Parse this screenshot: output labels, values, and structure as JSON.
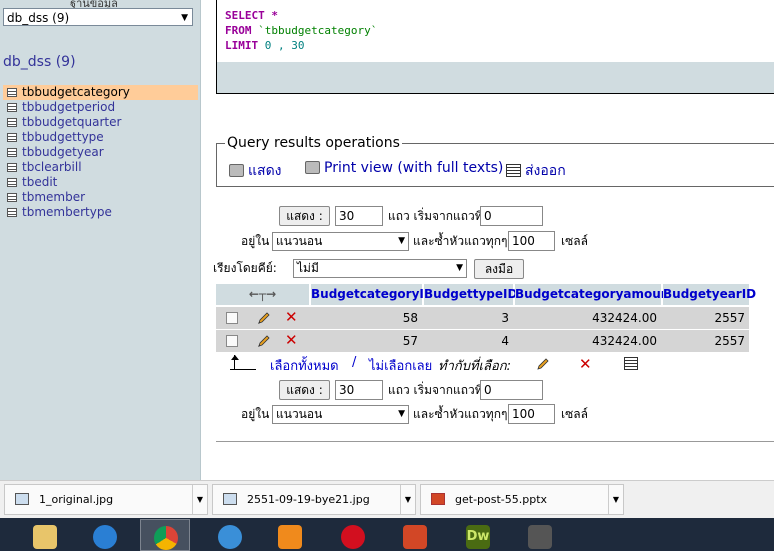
{
  "sidebar": {
    "top_label": "ฐานข้อมูล",
    "db_select": "db_dss (9)",
    "db_title": "db_dss (9)",
    "tables": [
      "tbbudgetcategory",
      "tbbudgetperiod",
      "tbbudgetquarter",
      "tbbudgettype",
      "tbbudgetyear",
      "tbclearbill",
      "tbedit",
      "tbmember",
      "tbmembertype"
    ]
  },
  "sql": {
    "line1_kw": "SELECT",
    "line1_rest": " *",
    "line2_kw": "FROM",
    "line2_table": " `tbbudgetcategory`",
    "line3_kw": "LIMIT",
    "line3_nums": " 0 , 30"
  },
  "qro": {
    "legend": "Query results operations",
    "show": "แสดง",
    "print": "Print view (with full texts)",
    "export": "ส่งออก"
  },
  "nav_top": {
    "show_btn": "แสดง :",
    "rows": "30",
    "rows_label": "แถว เริ่มจากแถวที่",
    "start": "0",
    "in_label": "อยู่ใน",
    "mode": "แนวนอน",
    "repeat_label": "และซ้ำหัวแถวทุกๆ",
    "repeat": "100",
    "cells_label": "เซลล์"
  },
  "sort": {
    "label": "เรียงโดยคีย์:",
    "value": "ไม่มี",
    "go_btn": "ลงมือ"
  },
  "grid": {
    "headers": [
      "BudgetcategoryID",
      "BudgettypeID",
      "Budgetcategoryamount",
      "BudgetyearID"
    ],
    "rows": [
      [
        "58",
        "3",
        "432424.00",
        "2557"
      ],
      [
        "57",
        "4",
        "432424.00",
        "2557"
      ]
    ]
  },
  "bulk": {
    "select_all": "เลือกทั้งหมด",
    "sep": " / ",
    "deselect": "ไม่เลือกเลย",
    "with_selected": "ทำกับที่เลือก:"
  },
  "nav_bottom": {
    "show_btn": "แสดง :",
    "rows": "30",
    "rows_label": "แถว เริ่มจากแถวที่",
    "start": "0",
    "in_label": "อยู่ใน",
    "mode": "แนวนอน",
    "repeat_label": "และซ้ำหัวแถวทุกๆ",
    "repeat": "100",
    "cells_label": "เซลล์"
  },
  "downloads": [
    "1_original.jpg",
    "2551-09-19-bye21.jpg",
    "get-post-55.pptx"
  ],
  "taskbar": {
    "icons": [
      "file-explorer-icon",
      "internet-explorer-icon",
      "chrome-icon",
      "itunes-icon",
      "media-player-icon",
      "opera-icon",
      "powerpoint-icon",
      "dreamweaver-icon",
      "app-icon"
    ],
    "dw_label": "Dw"
  }
}
